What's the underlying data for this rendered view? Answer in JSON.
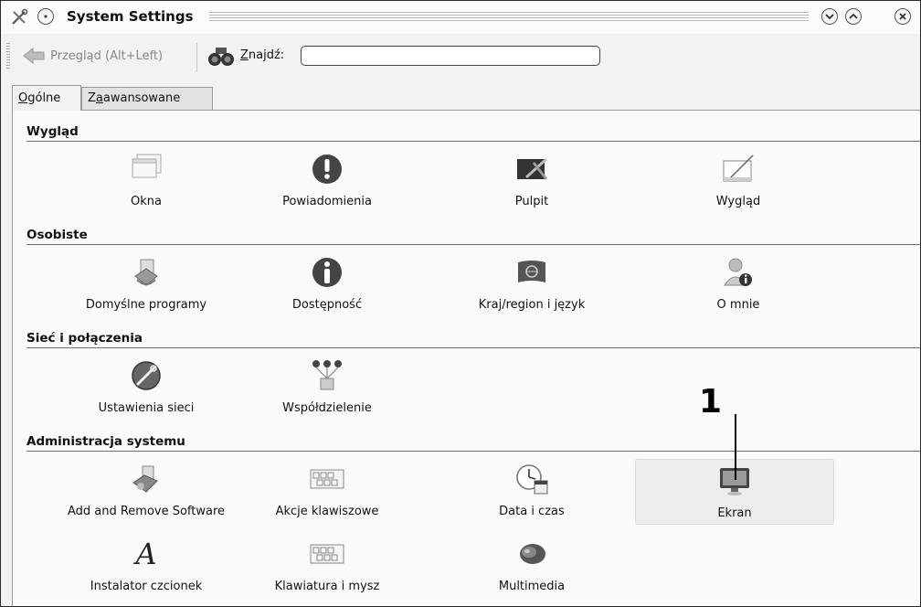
{
  "window": {
    "title": "System Settings"
  },
  "toolbar": {
    "back_label": "Przegląd (Alt+Left)",
    "find_label": "Znajdź:",
    "find_value": ""
  },
  "tabs": [
    {
      "label": "Ogólne",
      "active": true
    },
    {
      "label": "Zaawansowane",
      "active": false
    }
  ],
  "sections": [
    {
      "title": "Wygląd",
      "items": [
        {
          "label": "Okna",
          "icon": "windows-icon"
        },
        {
          "label": "Powiadomienia",
          "icon": "notification-icon"
        },
        {
          "label": "Pulpit",
          "icon": "desktop-icon"
        },
        {
          "label": "Wygląd",
          "icon": "appearance-icon"
        }
      ]
    },
    {
      "title": "Osobiste",
      "items": [
        {
          "label": "Domyślne programy",
          "icon": "default-apps-icon"
        },
        {
          "label": "Dostępność",
          "icon": "accessibility-icon"
        },
        {
          "label": "Kraj/region i język",
          "icon": "locale-flag-icon"
        },
        {
          "label": "O mnie",
          "icon": "user-info-icon"
        }
      ]
    },
    {
      "title": "Sieć i połączenia",
      "items": [
        {
          "label": "Ustawienia sieci",
          "icon": "network-globe-icon"
        },
        {
          "label": "Współdzielenie",
          "icon": "sharing-icon"
        }
      ]
    },
    {
      "title": "Administracja systemu",
      "items": [
        {
          "label": "Add and Remove Software",
          "icon": "software-package-icon"
        },
        {
          "label": "Akcje klawiszowe",
          "icon": "keyboard-actions-icon"
        },
        {
          "label": "Data i czas",
          "icon": "clock-calendar-icon"
        },
        {
          "label": "Ekran",
          "icon": "monitor-icon",
          "selected": true
        },
        {
          "label": "Instalator czcionek",
          "icon": "font-installer-icon"
        },
        {
          "label": "Klawiatura i mysz",
          "icon": "keyboard-mouse-icon"
        },
        {
          "label": "Multimedia",
          "icon": "speaker-icon"
        }
      ]
    }
  ],
  "annotation": {
    "number": "1"
  }
}
